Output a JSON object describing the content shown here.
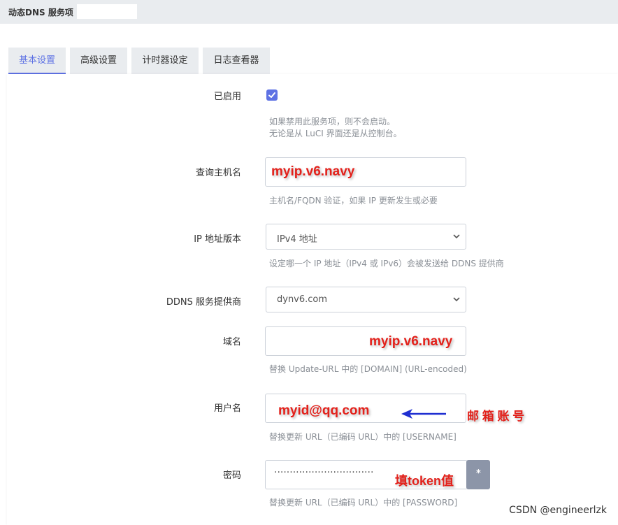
{
  "header": {
    "breadcrumb": "动态DNS 服务项 »"
  },
  "tabs": [
    {
      "label": "基本设置",
      "active": true
    },
    {
      "label": "高级设置"
    },
    {
      "label": "计时器设定"
    },
    {
      "label": "日志查看器"
    }
  ],
  "form": {
    "enabled": {
      "label": "已启用",
      "checked": true,
      "desc_line1": "如果禁用此服务项，则不会启动。",
      "desc_line2": "无论是从 LuCI 界面还是从控制台。"
    },
    "lookup_host": {
      "label": "查询主机名",
      "value": "myip.v6.navy",
      "desc": "主机名/FQDN 验证，如果 IP 更新发生或必要"
    },
    "ip_version": {
      "label": "IP 地址版本",
      "value": "IPv4 地址",
      "desc": "设定哪一个 IP 地址（IPv4 或 IPv6）会被发送给 DDNS 提供商"
    },
    "provider": {
      "label": "DDNS 服务提供商",
      "value": "dynv6.com"
    },
    "domain": {
      "label": "域名",
      "value": "myip.v6.navy",
      "desc": "替换 Update-URL 中的 [DOMAIN] (URL-encoded)"
    },
    "username": {
      "label": "用户名",
      "value": "myid@qq.com",
      "desc": "替换更新 URL（已编码 URL）中的 [USERNAME]"
    },
    "password": {
      "label": "密码",
      "mask": "································",
      "desc": "替换更新 URL（已编码 URL）中的 [PASSWORD]",
      "toggle_label": "*"
    }
  },
  "annotations": {
    "mailbox": "邮 箱 账 号",
    "token": "填token值",
    "arrow_color": "#1f2fd1"
  },
  "watermark": "CSDN @engineerlzk",
  "colors": {
    "accent": "#5e72e4",
    "annotation_red": "#e3211b"
  }
}
